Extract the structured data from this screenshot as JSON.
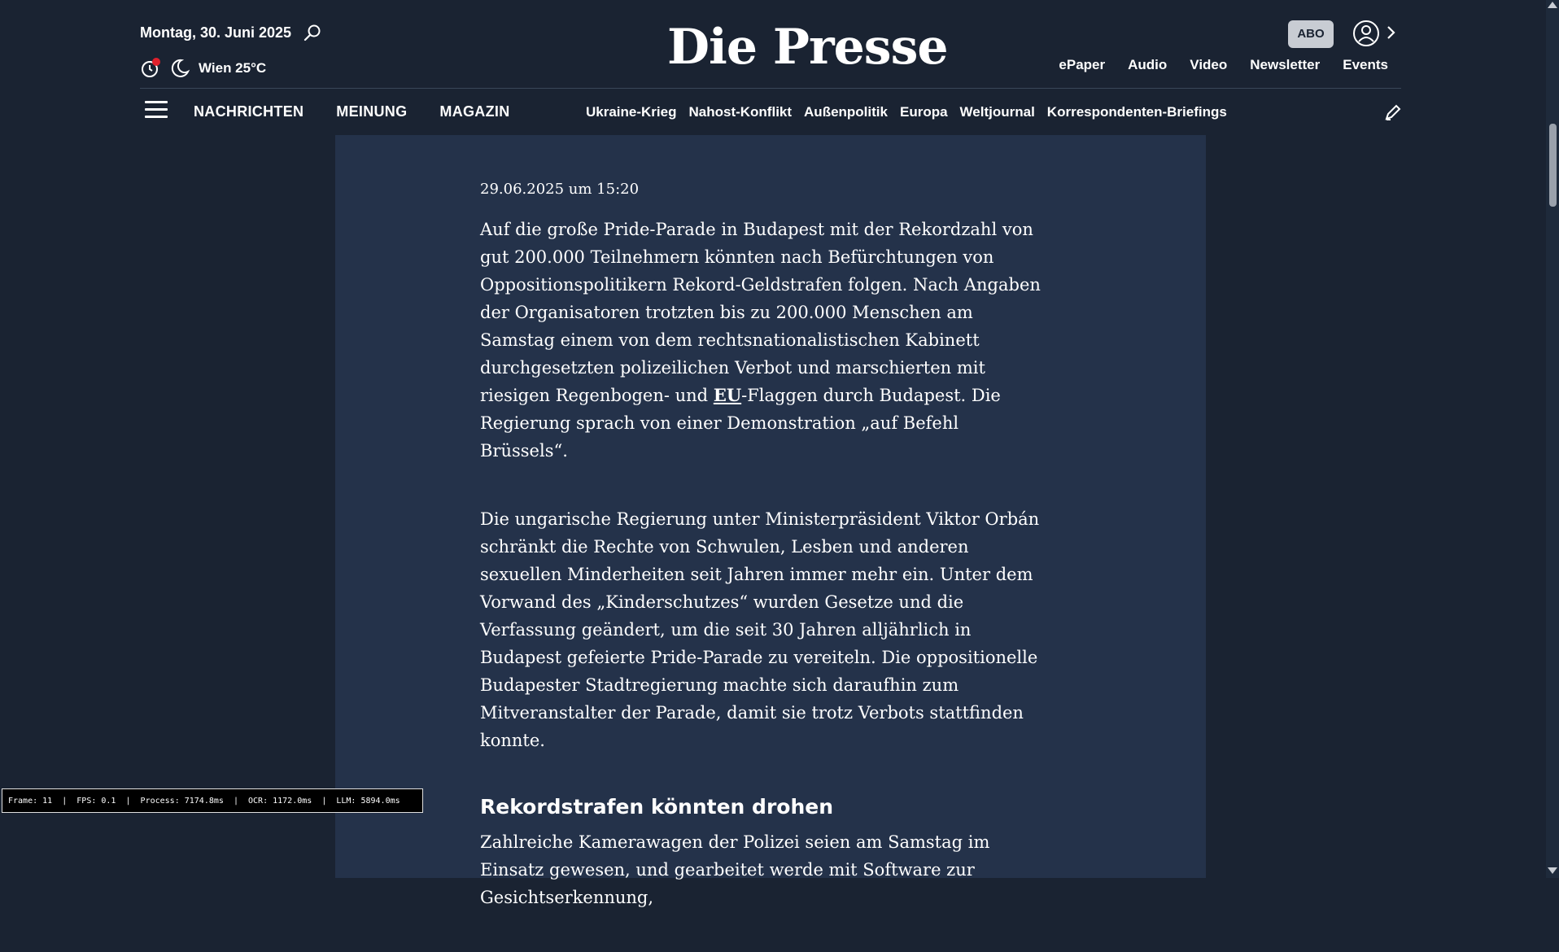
{
  "header": {
    "date": "Montag, 30. Juni 2025",
    "logo": "Die Presse",
    "abo_label": "ABO",
    "weather": "Wien 25°C",
    "top_links": [
      "ePaper",
      "Audio",
      "Video",
      "Newsletter",
      "Events"
    ]
  },
  "nav": {
    "main": [
      "NACHRICHTEN",
      "MEINUNG",
      "MAGAZIN"
    ],
    "sub": [
      "Ukraine-Krieg",
      "Nahost-Konflikt",
      "Außenpolitik",
      "Europa",
      "Weltjournal",
      "Korrespondenten-Briefings"
    ]
  },
  "article": {
    "timestamp": "29.06.2025 um 15:20",
    "p1_before": "Auf die große Pride-Parade in Budapest mit der Rekordzahl von gut 200.000 Teilnehmern könnten nach Befürchtungen von Oppositionspolitikern Rekord-Geldstrafen folgen. Nach Angaben der Organisatoren trotzten bis zu 200.000 Menschen am Samstag einem von dem rechtsnationalistischen Kabinett durchgesetzten polizeilichen Verbot und marschierten mit riesigen Regenbogen- und ",
    "p1_link": "EU",
    "p1_after": "-Flaggen durch Budapest. Die Regierung sprach von einer Demonstration „auf Befehl Brüssels“.",
    "p2": "Die ungarische Regierung unter Ministerpräsident Viktor Orbán schränkt die Rechte von Schwulen, Lesben und anderen sexuellen Minderheiten seit Jahren immer mehr ein. Unter dem Vorwand des „Kinderschutzes“ wurden Gesetze und die Verfassung geändert, um die seit 30 Jahren alljährlich in Budapest gefeierte Pride-Parade zu vereiteln. Die oppositionelle Budapester Stadtregierung machte sich daraufhin zum Mitveranstalter der Parade, damit sie trotz Verbots stattfinden konnte.",
    "h2": "Rekordstrafen könnten drohen",
    "p3": "Zahlreiche Kamerawagen der Polizei seien am Samstag im Einsatz gewesen, und gearbeitet werde mit Software zur Gesichtserkennung,"
  },
  "status_bar": "Frame: 11  |  FPS: 0.1  |  Process: 7174.8ms  |  OCR: 1172.0ms  |  LLM: 5894.0ms",
  "icons": [
    "search-icon",
    "history-icon",
    "moon-icon",
    "user-icon",
    "chevron-right-icon",
    "menu-icon",
    "pencil-icon"
  ],
  "colors": {
    "background": "#1a2332",
    "content": "#24324a",
    "abo_bg": "#c8ccd3",
    "notify_dot": "#e0202c"
  }
}
